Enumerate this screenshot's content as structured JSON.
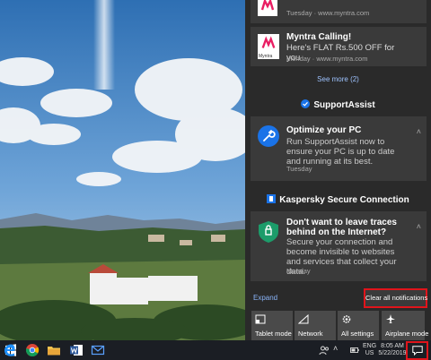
{
  "action_center": {
    "notif_top": {
      "partial_text": "Tuesday · www.myntra.com",
      "app_logo": "myntra-logo"
    },
    "notif_myntra": {
      "title": "Myntra Calling!",
      "body": "Here's FLAT  Rs.500 OFF for you",
      "meta": "Monday · www.myntra.com",
      "logo_text": "Myntra",
      "app_logo": "myntra-logo"
    },
    "see_more": "See more (2)",
    "support_assist": {
      "group_title": "SupportAssist",
      "title": "Optimize your PC",
      "body": "Run SupportAssist now to ensure your PC is up to date and running at its best.",
      "meta": "Tuesday",
      "icon": "wrench-icon"
    },
    "kaspersky": {
      "group_title": "Kaspersky Secure Connection",
      "title": "Don't want to leave traces behind on the Internet?",
      "body": "Secure your connection and become invisible to websites and services that collect your data.",
      "meta": "Monday",
      "icon": "kaspersky-shield-icon"
    },
    "expand_label": "Expand",
    "clear_all_label": "Clear all notifications",
    "quick_actions": [
      {
        "label": "Tablet mode",
        "icon": "tablet-mode-icon"
      },
      {
        "label": "Network",
        "icon": "network-icon"
      },
      {
        "label": "All settings",
        "icon": "gear-icon"
      },
      {
        "label": "Airplane mode",
        "icon": "airplane-icon"
      }
    ]
  },
  "taskbar": {
    "pinned": [
      "windows-start-icon",
      "edge-icon",
      "chrome-icon",
      "file-explorer-icon",
      "word-icon",
      "mail-icon"
    ],
    "lang_top": "ENG",
    "lang_bottom": "US",
    "time": "8:05 AM",
    "date": "5/22/2019"
  },
  "colors": {
    "highlight": "#e0141b",
    "accent_blue": "#1a73e8",
    "kaspersky_green": "#1c9c6a",
    "panel": "#2a2a2a",
    "card": "#3a3a3a"
  }
}
